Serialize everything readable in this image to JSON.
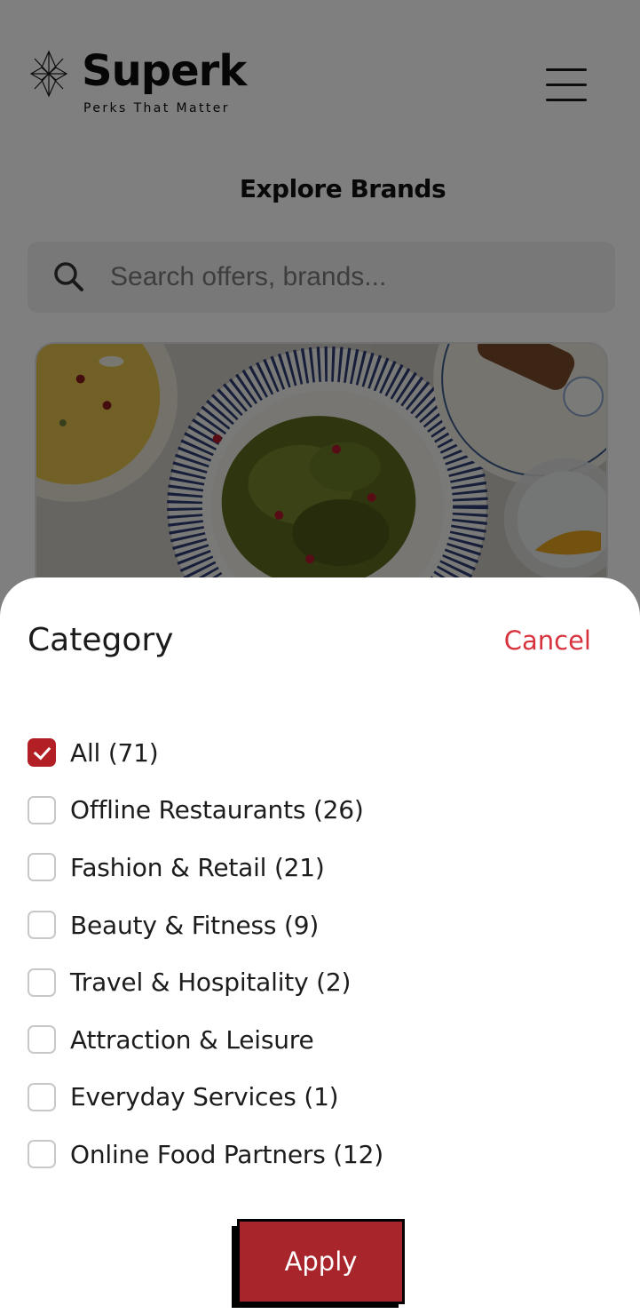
{
  "brand": {
    "name": "Superk",
    "tagline": "Perks That Matter"
  },
  "header": {
    "menu_icon": "hamburger-menu-icon"
  },
  "page": {
    "title": "Explore Brands"
  },
  "search": {
    "placeholder": "Search offers, brands...",
    "icon": "search-icon"
  },
  "colors": {
    "accent": "#b21f24",
    "cancel": "#d7333f",
    "apply_bg": "#a8262b"
  },
  "filter_sheet": {
    "title": "Category",
    "cancel_label": "Cancel",
    "options": [
      {
        "label": "All (71)",
        "checked": true
      },
      {
        "label": "Offline Restaurants (26)",
        "checked": false
      },
      {
        "label": "Fashion & Retail (21)",
        "checked": false
      },
      {
        "label": "Beauty & Fitness (9)",
        "checked": false
      },
      {
        "label": "Travel & Hospitality (2)",
        "checked": false
      },
      {
        "label": "Attraction & Leisure",
        "checked": false
      },
      {
        "label": "Everyday Services (1)",
        "checked": false
      },
      {
        "label": "Online Food Partners (12)",
        "checked": false
      }
    ],
    "apply_label": "Apply"
  }
}
